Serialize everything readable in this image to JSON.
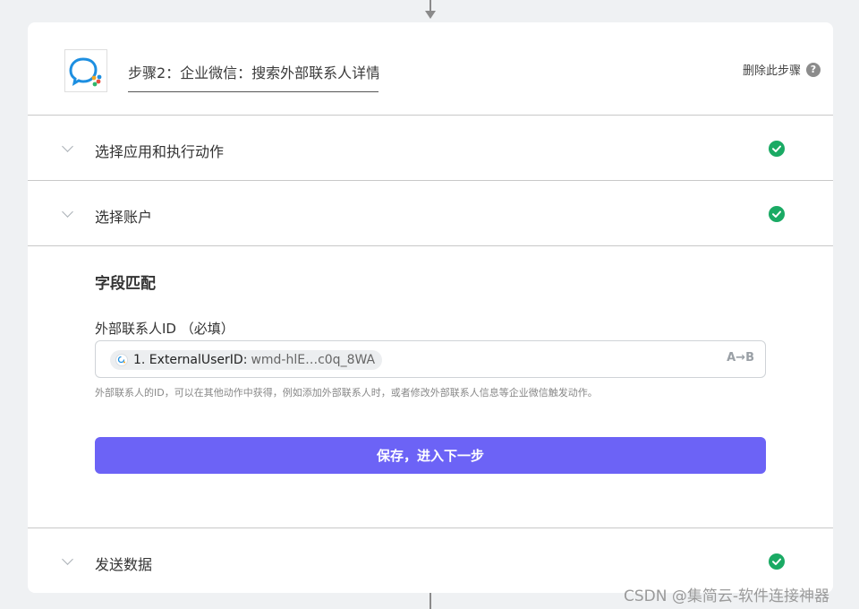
{
  "header": {
    "step_title": "步骤2：企业微信：搜索外部联系人详情",
    "delete_step": "删除此步骤",
    "help_glyph": "?"
  },
  "sections": [
    {
      "label": "选择应用和执行动作",
      "status": "complete"
    },
    {
      "label": "选择账户",
      "status": "complete"
    },
    {
      "label": "发送数据",
      "status": "complete"
    }
  ],
  "fields": {
    "title": "字段匹配",
    "external_id": {
      "label": "外部联系人ID （必填）",
      "token_name": "1. ExternalUserID:",
      "token_value": "wmd-hlE…c0q_8WA",
      "mode_icon": "A→B",
      "help": "外部联系人的ID，可以在其他动作中获得，例如添加外部联系人时，或者修改外部联系人信息等企业微信触发动作。"
    },
    "save_button": "保存，进入下一步"
  },
  "watermark": "CSDN @集简云-软件连接神器",
  "colors": {
    "accent": "#6c63f6",
    "success": "#1aaa64",
    "background": "#eff1f3"
  }
}
